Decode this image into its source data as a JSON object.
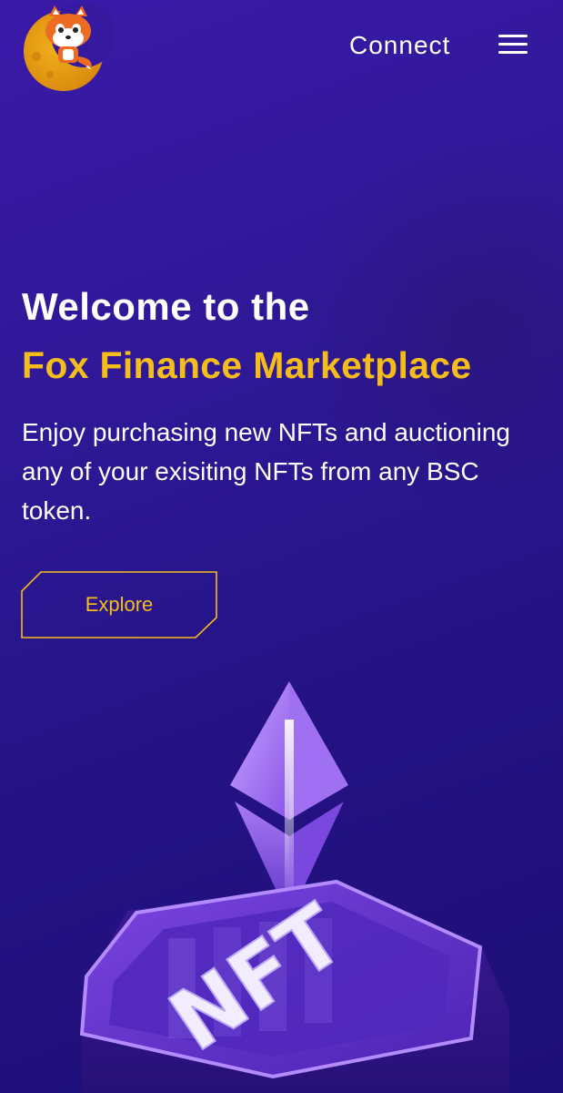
{
  "header": {
    "connect_label": "Connect"
  },
  "hero": {
    "title": "Welcome to the",
    "highlight": "Fox Finance Marketplace",
    "description": "Enjoy purchasing new NFTs and auctioning any of your exisiting NFTs from any BSC token.",
    "explore_label": "Explore"
  },
  "illustration": {
    "label": "NFT"
  },
  "colors": {
    "background": "#2e1896",
    "accent": "#f5bd19",
    "text": "#ffffff"
  },
  "icons": [
    "fox-logo-icon",
    "hamburger-menu-icon",
    "ethereum-icon"
  ]
}
